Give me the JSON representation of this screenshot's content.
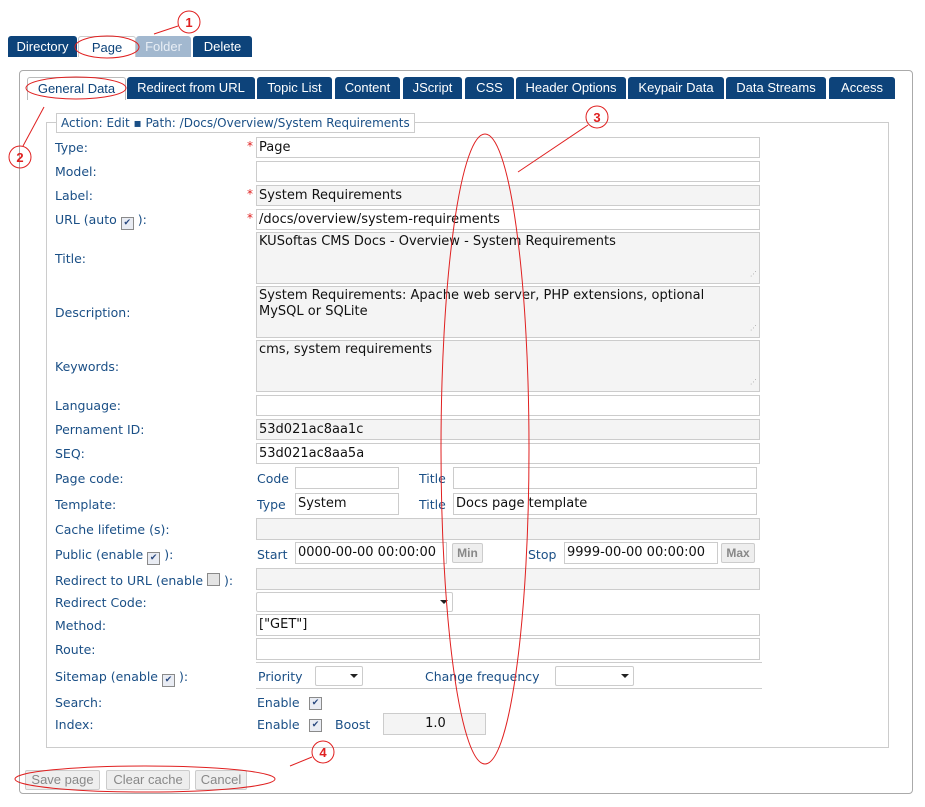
{
  "top_tabs": [
    {
      "label": "Directory",
      "state": "normal"
    },
    {
      "label": "Page",
      "state": "active"
    },
    {
      "label": "Folder",
      "state": "disabled"
    },
    {
      "label": "Delete",
      "state": "normal"
    }
  ],
  "section_tabs": [
    {
      "label": "General Data",
      "state": "active"
    },
    {
      "label": "Redirect from URL"
    },
    {
      "label": "Topic List"
    },
    {
      "label": "Content"
    },
    {
      "label": "JScript"
    },
    {
      "label": "CSS"
    },
    {
      "label": "Header Options"
    },
    {
      "label": "Keypair Data"
    },
    {
      "label": "Data Streams"
    },
    {
      "label": "Access"
    }
  ],
  "legend": "Action: Edit ▪ Path: /Docs/Overview/System Requirements",
  "fields": {
    "type": {
      "label": "Type:",
      "value": "Page",
      "required": true
    },
    "model": {
      "label": "Model:",
      "value": ""
    },
    "label": {
      "label": "Label:",
      "value": "System Requirements",
      "required": true
    },
    "url": {
      "label_pre": "URL (auto",
      "label_post": "):",
      "auto_checked": true,
      "value": "/docs/overview/system-requirements",
      "required": true
    },
    "title": {
      "label": "Title:",
      "value": "KUSoftas CMS Docs - Overview - System Requirements"
    },
    "description": {
      "label": "Description:",
      "value": "System Requirements: Apache web server, PHP extensions, optional\nMySQL or SQLite"
    },
    "keywords": {
      "label": "Keywords:",
      "value": "cms, system requirements"
    },
    "language": {
      "label": "Language:",
      "value": ""
    },
    "permanent_id": {
      "label": "Pernament ID:",
      "value": "53d021ac8aa1c"
    },
    "seq": {
      "label": "SEQ:",
      "value": "53d021ac8aa5a"
    },
    "page_code": {
      "label": "Page code:",
      "code_label": "Code",
      "code_value": "",
      "title_label": "Title",
      "title_value": ""
    },
    "template": {
      "label": "Template:",
      "type_label": "Type",
      "type_value": "System",
      "title_label": "Title",
      "title_value": "Docs page template"
    },
    "cache_lifetime": {
      "label": "Cache lifetime (s):",
      "value": ""
    },
    "public": {
      "label_pre": "Public (enable",
      "label_post": "):",
      "enabled": true,
      "start_label": "Start",
      "start_value": "0000-00-00 00:00:00",
      "min_label": "Min",
      "stop_label": "Stop",
      "stop_value": "9999-00-00 00:00:00",
      "max_label": "Max"
    },
    "redirect_url": {
      "label_pre": "Redirect to URL (enable",
      "label_post": "):",
      "enabled": false,
      "value": ""
    },
    "redirect_code": {
      "label": "Redirect Code:",
      "value": ""
    },
    "method": {
      "label": "Method:",
      "value": "[\"GET\"]"
    },
    "route": {
      "label": "Route:",
      "value": ""
    },
    "sitemap": {
      "label_pre": "Sitemap (enable",
      "label_post": "):",
      "enabled": true,
      "priority_label": "Priority",
      "priority_value": "",
      "freq_label": "Change frequency",
      "freq_value": ""
    },
    "search": {
      "label": "Search:",
      "enable_label": "Enable",
      "enabled": true
    },
    "index": {
      "label": "Index:",
      "enable_label": "Enable",
      "enabled": true,
      "boost_label": "Boost",
      "boost_value": "1.0"
    }
  },
  "actions": {
    "save": "Save page",
    "clear_cache": "Clear cache",
    "cancel": "Cancel"
  },
  "annotations": {
    "n1": "1",
    "n2": "2",
    "n3": "3",
    "n4": "4",
    "color": "#e02020"
  },
  "check_glyph": "✔"
}
